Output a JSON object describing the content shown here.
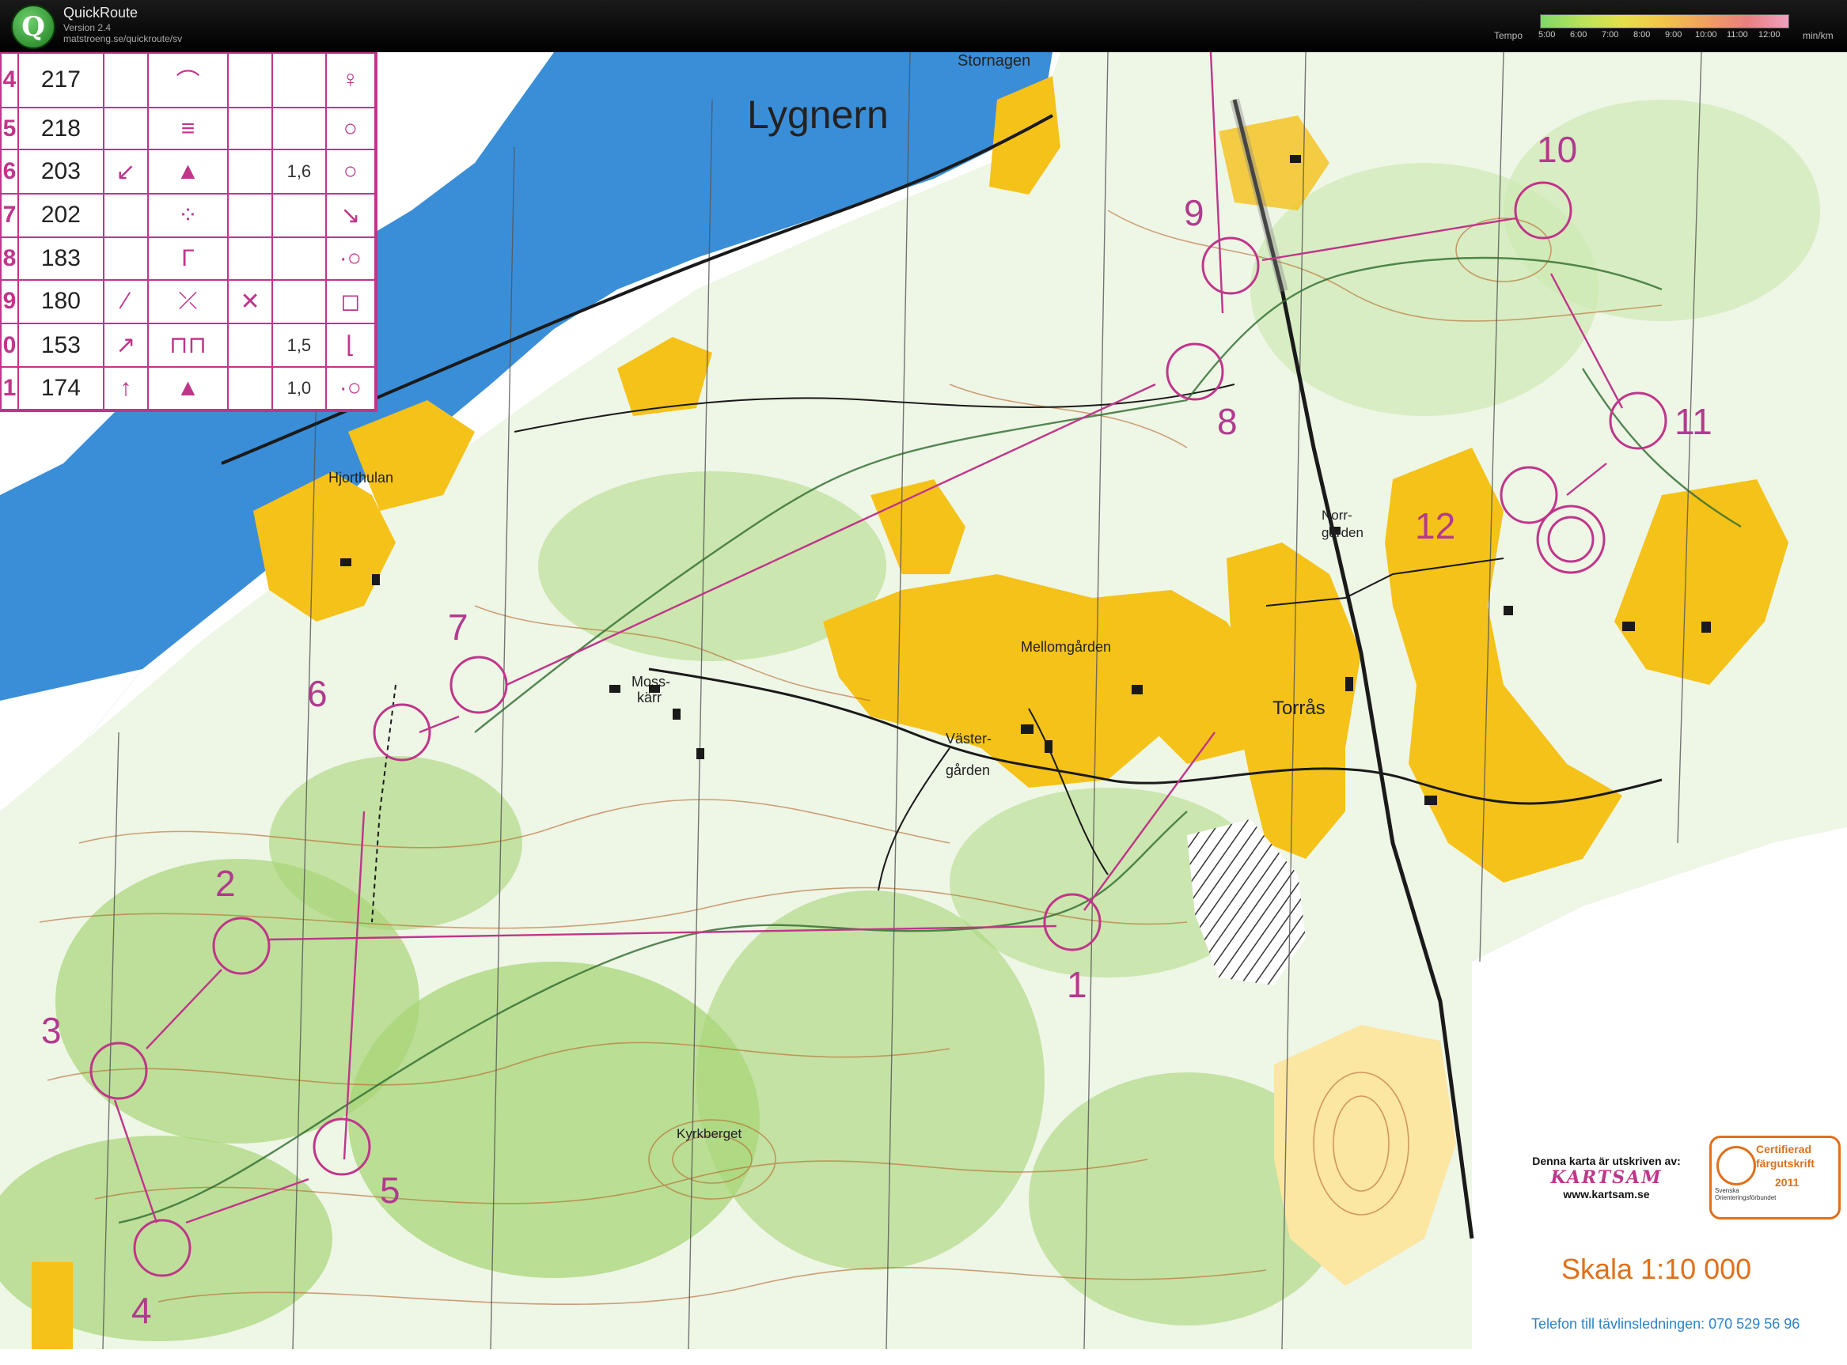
{
  "app": {
    "name": "QuickRoute",
    "version": "Version 2.4",
    "url": "matstroeng.se/quickroute/sv"
  },
  "tempo": {
    "label": "Tempo",
    "unit": "min/km",
    "ticks": [
      "5:00",
      "6:00",
      "7:00",
      "8:00",
      "9:00",
      "10:00",
      "11:00",
      "12:00"
    ]
  },
  "map": {
    "labels": {
      "lake": "Lygnern",
      "stornagen": "Stornagen",
      "hjorthulan": "Hjorthulan",
      "moss1": "Moss-",
      "moss2": "kärr",
      "mellomgarden": "Mellomgården",
      "vaster1": "Väster-",
      "vaster2": "gården",
      "norr1": "Norr-",
      "norr2": "gården",
      "torras": "Torrås",
      "kyrkberget": "Kyrkberget"
    },
    "controls": [
      "1",
      "2",
      "3",
      "4",
      "5",
      "6",
      "7",
      "8",
      "9",
      "10",
      "11",
      "12"
    ],
    "description_rows": [
      {
        "num": "4",
        "code": "217",
        "dir": "",
        "feature": "⌒",
        "detail": "",
        "size": "",
        "extra": "♀"
      },
      {
        "num": "5",
        "code": "218",
        "dir": "",
        "feature": "≡",
        "detail": "",
        "size": "",
        "extra": "○"
      },
      {
        "num": "6",
        "code": "203",
        "dir": "↙",
        "feature": "▲",
        "detail": "",
        "size": "1,6",
        "extra": "○"
      },
      {
        "num": "7",
        "code": "202",
        "dir": "",
        "feature": "⁘",
        "detail": "",
        "size": "",
        "extra": "↘"
      },
      {
        "num": "8",
        "code": "183",
        "dir": "",
        "feature": "Γ",
        "detail": "",
        "size": "",
        "extra": "·○"
      },
      {
        "num": "9",
        "code": "180",
        "dir": "⁄",
        "feature": "⤫",
        "detail": "✕",
        "size": "",
        "extra": "◻"
      },
      {
        "num": "0",
        "code": "153",
        "dir": "↗",
        "feature": "⊓⊓",
        "detail": "",
        "size": "1,5",
        "extra": "⌊"
      },
      {
        "num": "1",
        "code": "174",
        "dir": "↑",
        "feature": "▲",
        "detail": "",
        "size": "1,0",
        "extra": "·○"
      }
    ],
    "credit": {
      "line1": "Denna karta är utskriven av:",
      "logo": "KARTSAM",
      "line2": "www.kartsam.se"
    },
    "certificate": {
      "line1": "Certifierad",
      "line2": "färgutskrift",
      "year": "2011",
      "org": "Svenska Orienteringsförbundet"
    },
    "scale": "Skala 1:10 000",
    "phone": "Telefon till tävlinsledningen: 070 529 56 96"
  },
  "colors": {
    "water": "#3a8ed8",
    "open_land": "#f5c21a",
    "forest_green": "#a8d678",
    "course": "#c0358a",
    "contour": "#b5652a"
  }
}
